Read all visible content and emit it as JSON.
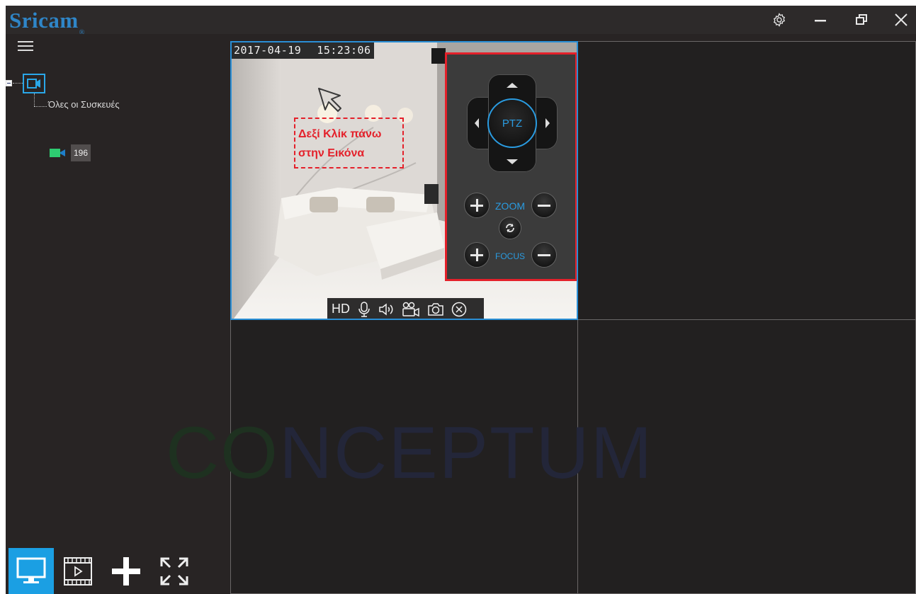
{
  "app": {
    "logo": "Sricam",
    "logo_mark": "®"
  },
  "window_controls": [
    "settings-icon",
    "minimize-icon",
    "restore-icon",
    "close-icon"
  ],
  "sidebar": {
    "tree_root_icon": "camera-icon",
    "group_label": "Όλες οι Συσκευές",
    "devices": [
      {
        "label": "196",
        "icon": "camera-icon",
        "status_color": "#2ecc71"
      }
    ],
    "bottom_tools": [
      "monitor-icon",
      "playback-film-icon",
      "add-icon",
      "fullscreen-icon"
    ]
  },
  "viewer": {
    "timestamp_date": "2017-04-19",
    "timestamp_time": "15:23:06",
    "annotation_line1": "Δεξί Κλίκ πάνω",
    "annotation_line2": "στην Εικόνα",
    "toolbar": {
      "hd_label": "HD",
      "icons": [
        "microphone-icon",
        "speaker-icon",
        "record-video-icon",
        "snapshot-camera-icon",
        "close-stream-icon"
      ]
    },
    "ptz": {
      "center_label": "PTZ",
      "zoom_label": "ZOOM",
      "focus_label": "FOCUS"
    }
  },
  "watermark": {
    "part1": "CO",
    "part2": "NCEPTUM"
  },
  "colors": {
    "accent": "#1b9fe3",
    "logo": "#2f86c8",
    "annotation": "#e4202a",
    "background": "#282424"
  }
}
